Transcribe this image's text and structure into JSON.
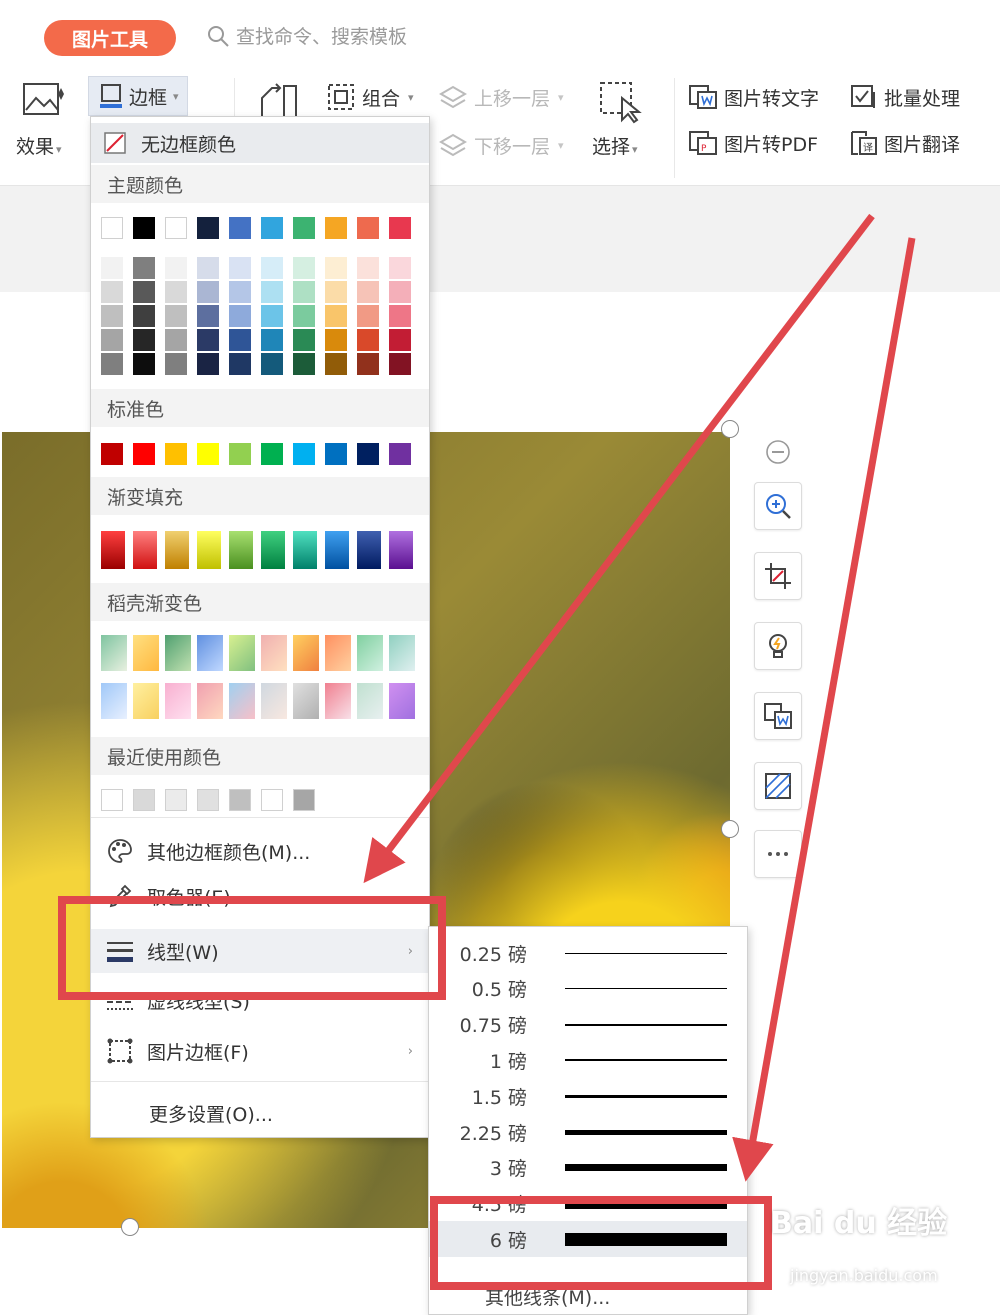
{
  "ribbon": {
    "tab": "图片工具",
    "search_placeholder": "查找命令、搜索模板",
    "effect": "效果",
    "border": "边框",
    "group": "组合",
    "bring_forward": "上移一层",
    "send_backward": "下移一层",
    "select": "选择",
    "img_to_text": "图片转文字",
    "batch": "批量处理",
    "img_to_pdf": "图片转PDF",
    "translate": "图片翻译"
  },
  "menu": {
    "no_border_color": "无边框颜色",
    "theme_colors": "主题颜色",
    "standard_colors": "标准色",
    "gradient_fill": "渐变填充",
    "docer_gradient": "稻壳渐变色",
    "recent_colors": "最近使用颜色",
    "other_colors": "其他边框颜色(M)...",
    "eyedropper": "取色器(E)",
    "line_style": "线型(W)",
    "dash_style": "虚线线型(S)",
    "picture_border": "图片边框(F)",
    "more_settings": "更多设置(O)..."
  },
  "palettes": {
    "theme_top": [
      "#ffffff",
      "#000000",
      "#ffffff",
      "#14213d",
      "#4472c4",
      "#31a5de",
      "#3cb371",
      "#f5a623",
      "#ee6a4e",
      "#e8384f"
    ],
    "theme_shades": [
      [
        "#f2f2f2",
        "#7f7f7f",
        "#f2f2f2",
        "#d6dcea",
        "#d9e2f3",
        "#d6edf8",
        "#d5efe1",
        "#fdeed3",
        "#fbe1db",
        "#fad7dc"
      ],
      [
        "#d9d9d9",
        "#595959",
        "#d9d9d9",
        "#aab6d3",
        "#b4c6e7",
        "#ade0f2",
        "#aee0c4",
        "#fbdca8",
        "#f6c3b7",
        "#f4afb9"
      ],
      [
        "#bfbfbf",
        "#3f3f3f",
        "#bfbfbf",
        "#5d6f9f",
        "#8eaadb",
        "#6cc4e8",
        "#7bcb9e",
        "#f9c56a",
        "#f19a85",
        "#ee7687"
      ],
      [
        "#a5a5a5",
        "#262626",
        "#a5a5a5",
        "#2b3a66",
        "#2f5597",
        "#1f86b8",
        "#2a8a55",
        "#d98a0c",
        "#d9492a",
        "#c21d34"
      ],
      [
        "#7f7f7f",
        "#0d0d0d",
        "#7f7f7f",
        "#1a2444",
        "#1f3864",
        "#145a7b",
        "#1c5c39",
        "#915c08",
        "#91311c",
        "#821323"
      ]
    ],
    "standard": [
      "#c00000",
      "#ff0000",
      "#ffc000",
      "#ffff00",
      "#92d050",
      "#00b050",
      "#00b0f0",
      "#0070c0",
      "#002060",
      "#7030a0"
    ],
    "gradients": [
      [
        "#ff4040",
        "#9a0000"
      ],
      [
        "#ff8080",
        "#d01010"
      ],
      [
        "#f0d070",
        "#c08000"
      ],
      [
        "#ffff60",
        "#c0c000"
      ],
      [
        "#a8e070",
        "#4a9020"
      ],
      [
        "#40d080",
        "#008040"
      ],
      [
        "#50e0c0",
        "#00806a"
      ],
      [
        "#40a0f0",
        "#0050a0"
      ],
      [
        "#4060b0",
        "#001a60"
      ],
      [
        "#b070e0",
        "#5a1090"
      ]
    ],
    "docer_row1": [
      [
        "#7fc4a0",
        "#e8f0e0"
      ],
      [
        "#ffe080",
        "#ffb840"
      ],
      [
        "#50a070",
        "#c0e0b0"
      ],
      [
        "#6090e0",
        "#c0d8ff"
      ],
      [
        "#d8f090",
        "#80c080"
      ],
      [
        "#f0b0b0",
        "#ffe0c0"
      ],
      [
        "#ffd060",
        "#f08040"
      ],
      [
        "#ff9060",
        "#ffd0a0"
      ],
      [
        "#80d0a0",
        "#d0f0e0"
      ],
      [
        "#90d0c0",
        "#e0f0f0"
      ]
    ],
    "docer_row2": [
      [
        "#a0c8f8",
        "#e8f0ff"
      ],
      [
        "#fff0a0",
        "#f8d060"
      ],
      [
        "#f8b0d0",
        "#ffe0f0"
      ],
      [
        "#f0a0b0",
        "#ffd8c0"
      ],
      [
        "#a0d0f0",
        "#f8c0c8"
      ],
      [
        "#d0d8e0",
        "#f8e8e0"
      ],
      [
        "#e0e0e0",
        "#b0b0b0"
      ],
      [
        "#f08090",
        "#f8e0e8"
      ],
      [
        "#c0e0d0",
        "#e8f0f0"
      ],
      [
        "#d090f0",
        "#a070e0"
      ]
    ],
    "recent": [
      "#ffffff",
      "#d9d9d9",
      "#ebebeb",
      "#e0e0e0",
      "#bfbfbf",
      "#ffffff",
      "#a6a6a6"
    ]
  },
  "weights": [
    {
      "label": "0.25 磅",
      "pt": 0.25
    },
    {
      "label": "0.5 磅",
      "pt": 0.5
    },
    {
      "label": "0.75 磅",
      "pt": 0.75
    },
    {
      "label": "1 磅",
      "pt": 1
    },
    {
      "label": "1.5 磅",
      "pt": 1.5
    },
    {
      "label": "2.25 磅",
      "pt": 2.25
    },
    {
      "label": "3 磅",
      "pt": 3
    },
    {
      "label": "4.5 磅",
      "pt": 4.5
    },
    {
      "label": "6 磅",
      "pt": 6
    }
  ],
  "selected_weight": "6 磅",
  "submenu_more": "其他线条(M)...",
  "watermark": "Bai du 经验",
  "watermark_sub": "jingyan.baidu.com",
  "colors": {
    "accent": "#f36a4a",
    "annotation": "#e0474c"
  }
}
